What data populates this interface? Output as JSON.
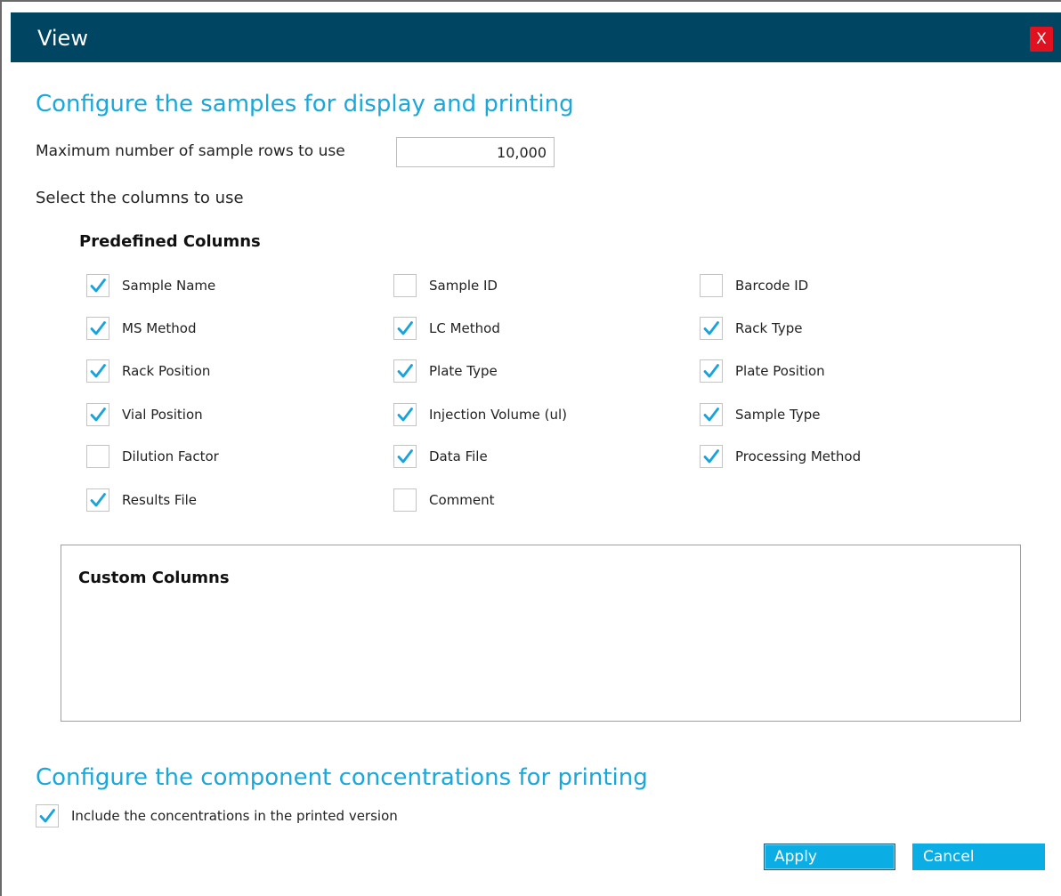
{
  "window": {
    "title": "View",
    "close_label": "X"
  },
  "samples": {
    "heading": "Configure the samples for display and printing",
    "max_rows_label": "Maximum number of sample rows to use",
    "max_rows_value": "10,000",
    "select_columns_label": "Select the columns to use"
  },
  "predefined": {
    "title": "Predefined Columns",
    "items": [
      {
        "label": "Sample Name",
        "checked": true
      },
      {
        "label": "Sample ID",
        "checked": false
      },
      {
        "label": "Barcode ID",
        "checked": false
      },
      {
        "label": "MS Method",
        "checked": true
      },
      {
        "label": "LC Method",
        "checked": true
      },
      {
        "label": "Rack Type",
        "checked": true
      },
      {
        "label": "Rack Position",
        "checked": true
      },
      {
        "label": "Plate Type",
        "checked": true
      },
      {
        "label": "Plate Position",
        "checked": true
      },
      {
        "label": "Vial Position",
        "checked": true
      },
      {
        "label": "Injection Volume (ul)",
        "checked": true
      },
      {
        "label": "Sample Type",
        "checked": true
      },
      {
        "label": "Dilution Factor",
        "checked": false
      },
      {
        "label": "Data File",
        "checked": true
      },
      {
        "label": "Processing Method",
        "checked": true
      },
      {
        "label": "Results File",
        "checked": true
      },
      {
        "label": "Comment",
        "checked": false
      }
    ]
  },
  "custom": {
    "title": "Custom Columns"
  },
  "concentrations": {
    "heading": "Configure the component concentrations for printing",
    "include_label": "Include the concentrations in the printed version",
    "include_checked": true
  },
  "buttons": {
    "apply": "Apply",
    "cancel": "Cancel"
  },
  "colors": {
    "titlebar": "#004663",
    "accent": "#1aa7da",
    "check": "#17a3dc",
    "button": "#0aaee5",
    "close": "#e0121f"
  },
  "icons": {
    "checked": "checkmark-icon"
  }
}
